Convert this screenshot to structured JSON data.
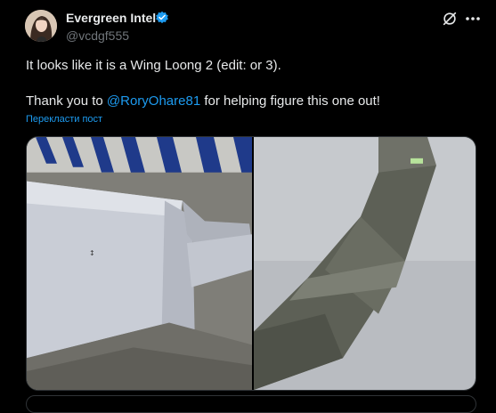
{
  "author": {
    "name": "Evergreen Intel",
    "handle": "@vcdgf555",
    "verified_color": "#1d9bf0"
  },
  "post": {
    "line1": "It looks like it is a Wing Loong 2 (edit: or 3).",
    "line2_prefix": "Thank you to ",
    "mention": "@RoryOhare81",
    "line2_suffix": " for helping figure this one out!",
    "translate_label": "Перекласти пост"
  },
  "media": {
    "photos": [
      {
        "subject": "grey wing segment with wingtip on tarmac, blue-white striped curb behind"
      },
      {
        "subject": "swept winglet of grey aircraft against pale sky"
      }
    ]
  },
  "icons": {
    "grok": "grok-icon",
    "more": "more-options-icon",
    "verified": "verified-badge-icon"
  },
  "colors": {
    "background": "#000000",
    "text": "#e7e9ea",
    "muted": "#71767b",
    "accent": "#1d9bf0"
  }
}
